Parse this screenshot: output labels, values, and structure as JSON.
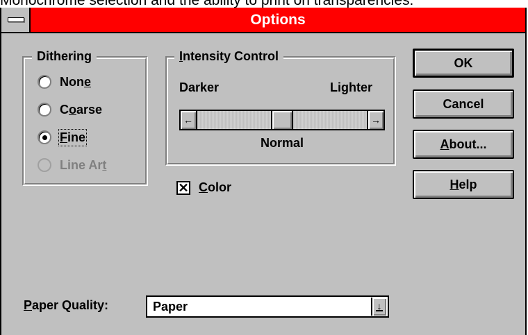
{
  "background_caption": "Monochrome selection and the ability to print on transparencies.",
  "window": {
    "title": "Options"
  },
  "dithering": {
    "legend": "Dithering",
    "options": [
      {
        "label_pre": "Non",
        "label_key": "e",
        "label_post": "",
        "state": "unchecked"
      },
      {
        "label_pre": "C",
        "label_key": "o",
        "label_post": "arse",
        "state": "unchecked"
      },
      {
        "label_pre": "",
        "label_key": "F",
        "label_post": "ine",
        "state": "checked"
      },
      {
        "label_pre": "Line Ar",
        "label_key": "t",
        "label_post": "",
        "state": "disabled"
      }
    ]
  },
  "intensity": {
    "legend_key": "I",
    "legend_rest": "ntensity Control",
    "darker_label": "Darker",
    "lighter_label": "Lighter",
    "value_label": "Normal",
    "slider_level": 0.5
  },
  "color_checkbox": {
    "label_key": "C",
    "label_rest": "olor",
    "checked": true,
    "mark": "✕"
  },
  "buttons": {
    "ok": "OK",
    "cancel": "Cancel",
    "about_key": "A",
    "about_rest": "bout...",
    "help_key": "H",
    "help_rest": "elp"
  },
  "paper_quality": {
    "label_key": "P",
    "label_rest": "aper Quality:",
    "value": "Paper"
  },
  "icons": {
    "scroll_left": "←",
    "scroll_right": "→",
    "dropdown": "↓"
  }
}
